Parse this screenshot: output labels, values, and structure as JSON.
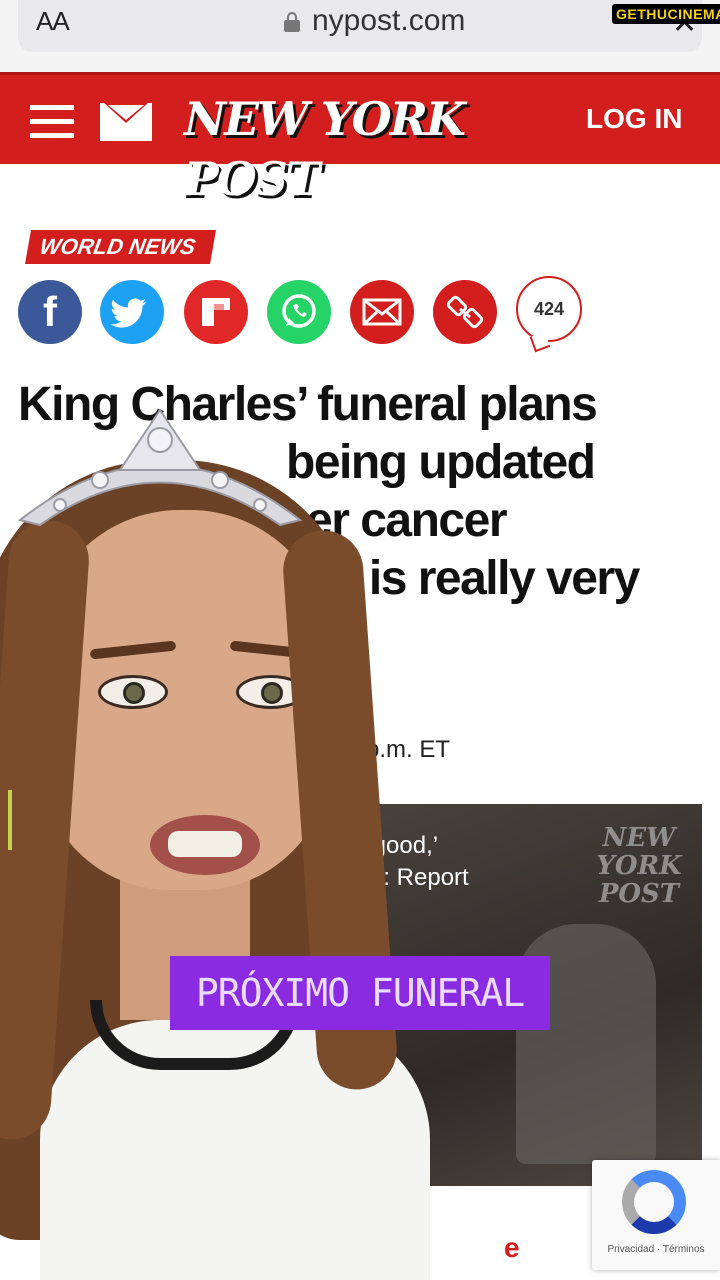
{
  "browser": {
    "text_size_label": "AA",
    "domain": "nypost.com",
    "close_label": "✕",
    "watermark": "GETHUCINEMA"
  },
  "masthead": {
    "logo_text": "NEW YORK POST",
    "login_label": "LOG IN",
    "brand_color": "#d31e1e"
  },
  "article": {
    "section": "WORLD NEWS",
    "share": {
      "facebook_glyph": "f",
      "comment_count": "424"
    },
    "headline_lines": [
      "King Charles’ funeral plans",
      "being updated",
      "er cancer",
      "le is really very"
    ],
    "timestamp_partial": "4 p.m. ET",
    "video": {
      "caption_line1": "ot good,’",
      "caption_line2": "vay: Report",
      "watermark": "NEW YORK POST"
    }
  },
  "overlay": {
    "caption": "PRÓXIMO FUNERAL",
    "color": "#8a2be2"
  },
  "recaptcha": {
    "links": "Privacidad · Términos"
  },
  "partial_red_text": "e"
}
